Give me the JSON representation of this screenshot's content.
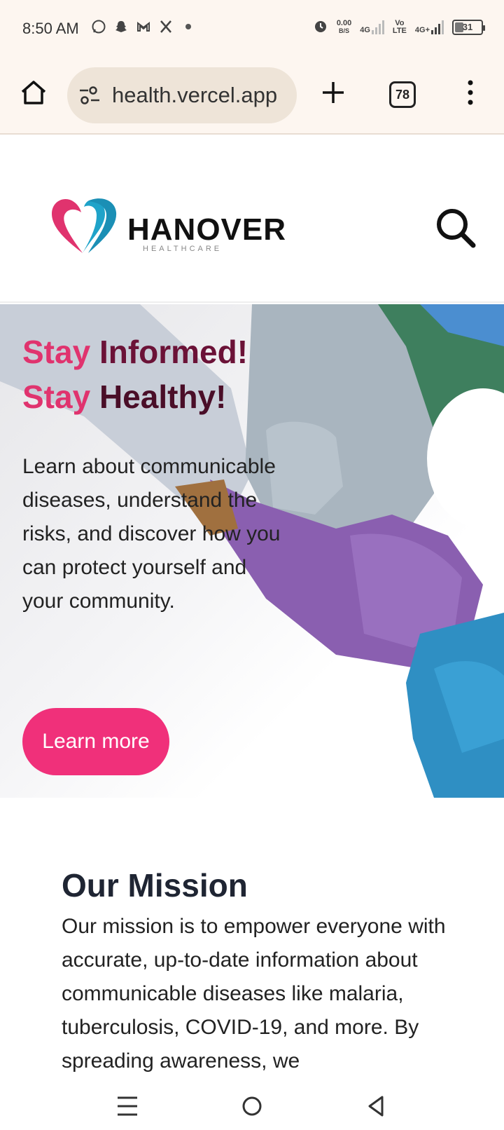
{
  "status": {
    "time": "8:50 AM",
    "net_speed_value": "0.00",
    "net_speed_unit": "B/S",
    "net_4g": "4G",
    "volte_top": "Vo",
    "volte_bottom": "LTE",
    "net_4g_plus": "4G+",
    "battery": "31",
    "icons_left": [
      "whatsapp-icon",
      "snapchat-icon",
      "gmail-icon",
      "x-icon",
      "dot-icon"
    ]
  },
  "browser": {
    "url": "health.vercel.app",
    "tab_count": "78"
  },
  "site": {
    "logo_word": "HANOVER",
    "logo_sub": "HEALTHCARE"
  },
  "hero": {
    "title_line1_a": "Stay ",
    "title_line1_b": "Informed!",
    "title_line2_a": "Stay ",
    "title_line2_b": "Healthy!",
    "description": "Learn about communicable diseases, understand the risks, and discover how you can protect yourself and your community.",
    "button_label": "Learn more"
  },
  "mission": {
    "title": "Our Mission",
    "text": "Our mission is to empower everyone with accurate, up-to-date information about communicable diseases like malaria, tuberculosis, COVID-19, and more. By spreading awareness, we"
  },
  "colors": {
    "accent_pink": "#f0307a",
    "title_pink": "#e0336e",
    "title_dark": "#6b1237",
    "browser_bg": "#fdf6f0"
  }
}
